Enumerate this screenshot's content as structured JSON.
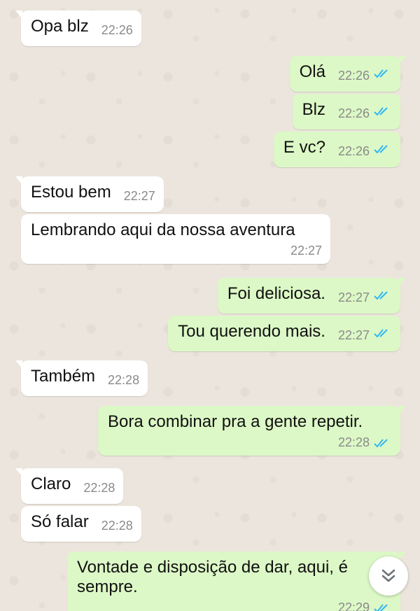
{
  "messages": [
    {
      "id": 0,
      "direction": "in",
      "text": "Opa blz",
      "time": "22:26"
    },
    {
      "id": 1,
      "direction": "out",
      "text": "Olá",
      "time": "22:26",
      "status": "read"
    },
    {
      "id": 2,
      "direction": "out",
      "text": "Blz",
      "time": "22:26",
      "status": "read"
    },
    {
      "id": 3,
      "direction": "out",
      "text": "E vc?",
      "time": "22:26",
      "status": "read"
    },
    {
      "id": 4,
      "direction": "in",
      "text": "Estou bem",
      "time": "22:27"
    },
    {
      "id": 5,
      "direction": "in",
      "text": "Lembrando aqui da nossa aventura",
      "time": "22:27"
    },
    {
      "id": 6,
      "direction": "out",
      "text": "Foi deliciosa.",
      "time": "22:27",
      "status": "read"
    },
    {
      "id": 7,
      "direction": "out",
      "text": "Tou querendo mais.",
      "time": "22:27",
      "status": "read"
    },
    {
      "id": 8,
      "direction": "in",
      "text": "Também",
      "time": "22:28"
    },
    {
      "id": 9,
      "direction": "out",
      "text": "Bora combinar pra a gente repetir.",
      "time": "22:28",
      "status": "read"
    },
    {
      "id": 10,
      "direction": "in",
      "text": "Claro",
      "time": "22:28"
    },
    {
      "id": 11,
      "direction": "in",
      "text": "Só falar",
      "time": "22:28"
    },
    {
      "id": 12,
      "direction": "out",
      "text": "Vontade e disposição de dar, aqui, é sempre.",
      "time": "22:29",
      "status": "read"
    }
  ],
  "colors": {
    "incoming_bubble": "#ffffff",
    "outgoing_bubble": "#dcf8c6",
    "read_ticks": "#34b7f1",
    "wallpaper": "#ece5dd"
  },
  "icons": {
    "read_ticks": "double-check-icon",
    "scroll_down": "chevron-double-down-icon"
  }
}
